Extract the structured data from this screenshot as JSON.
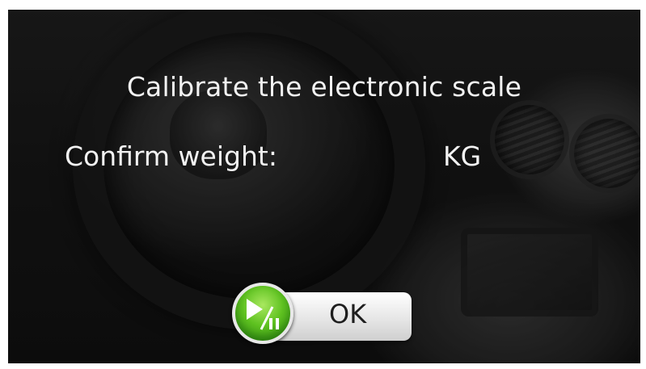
{
  "dialog": {
    "title": "Calibrate the electronic scale",
    "confirm_label": "Confirm weight:",
    "weight_value": "",
    "unit": "KG"
  },
  "ok_button": {
    "label": "OK",
    "icon": "play-pause-icon",
    "icon_color": "#5fc221"
  },
  "background": {
    "image": "car-interior-photo",
    "tint": "#1b1b1b"
  }
}
